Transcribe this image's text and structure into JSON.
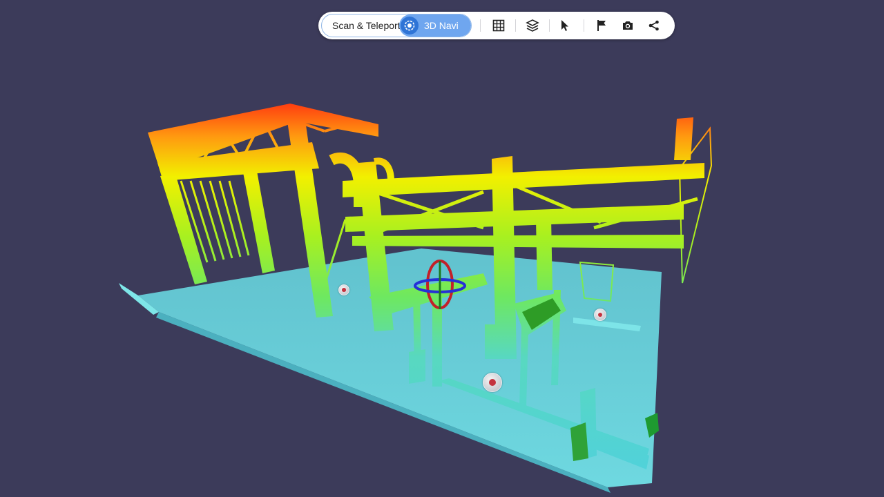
{
  "toolbar": {
    "mode_scan_label": "Scan & Teleport",
    "mode_3d_label": "3D Navi",
    "active_mode": "3D Navi",
    "tools": [
      {
        "name": "grid-icon"
      },
      {
        "name": "layers-icon"
      },
      {
        "name": "pointer-icon"
      },
      {
        "name": "flag-icon"
      },
      {
        "name": "camera-icon"
      },
      {
        "name": "share-icon"
      }
    ]
  },
  "colors": {
    "background": "#3c3b5a",
    "toggle_active": "#6fa6ef",
    "toggle_knob": "#2f74d6",
    "elevation_low": "#5fd8d8",
    "elevation_mid": "#a8f020",
    "elevation_high": "#ff2a10"
  },
  "scan_markers": 3
}
